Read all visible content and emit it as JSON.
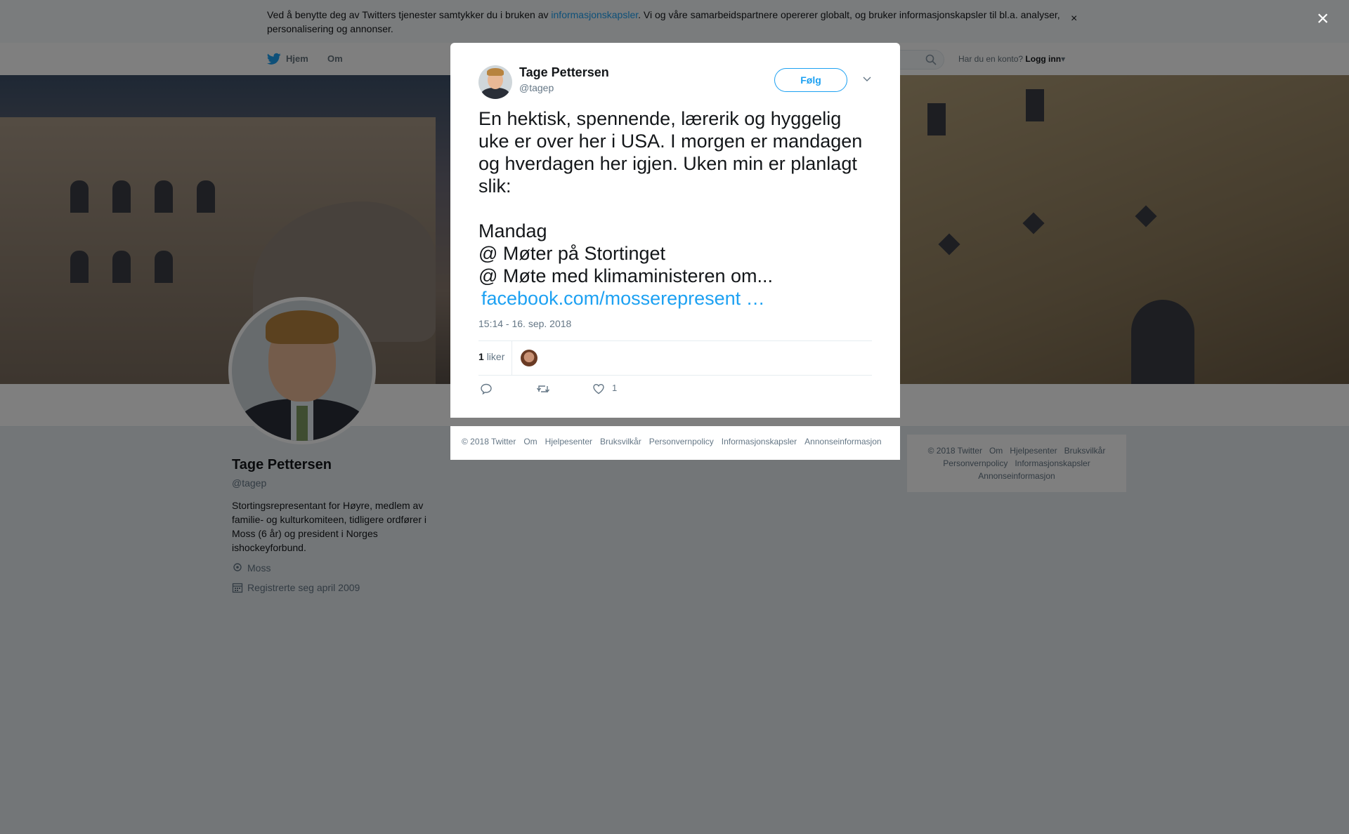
{
  "cookie_banner": {
    "text_before": "Ved å benytte deg av Twitters tjenester samtykker du i bruken av ",
    "link": "informasjonskapsler",
    "text_after": ". Vi og våre samarbeidspartnere opererer globalt, og bruker informasjonskapsler til bl.a. analyser, personalisering og annonser.",
    "close": "×"
  },
  "topnav": {
    "home": "Hjem",
    "about": "Om",
    "have_account": "Har du en konto?",
    "login": "Logg inn"
  },
  "profile": {
    "name": "Tage Pettersen",
    "handle": "@tagep",
    "bio": "Stortingsrepresentant for Høyre, medlem av familie- og kulturkomiteen, tidligere ordfører i Moss (6 år) og president i Norges ishockeyforbund.",
    "location": "Moss",
    "joined": "Registrerte seg april 2009"
  },
  "sidebar_footer": [
    "© 2018 Twitter",
    "Om",
    "Hjelpesenter",
    "Bruksvilkår",
    "Personvernpolicy",
    "Informasjonskapsler",
    "Annonseinformasjon"
  ],
  "modal": {
    "close": "×",
    "author_name": "Tage Pettersen",
    "author_handle": "@tagep",
    "follow": "Følg",
    "tweet_lines": [
      "En hektisk, spennende, lærerik og hyggelig",
      "uke er over her i USA. I morgen er mandagen",
      "og hverdagen her igjen. Uken min er planlagt",
      "slik:",
      "",
      "Mandag",
      "@ Møter på Stortinget",
      "@ Møte med klimaministeren om..."
    ],
    "tweet_link": "facebook.com/mosserepresent …",
    "timestamp": "15:14 - 16. sep. 2018",
    "likes_count": "1",
    "likes_label": "liker",
    "action_like_count": "1"
  },
  "modal_footer": [
    "© 2018 Twitter",
    "Om",
    "Hjelpesenter",
    "Bruksvilkår",
    "Personvernpolicy",
    "Informasjonskapsler",
    "Annonseinformasjon"
  ],
  "colors": {
    "accent": "#1da1f2",
    "overlay": "rgba(0,0,0,0.5)"
  }
}
